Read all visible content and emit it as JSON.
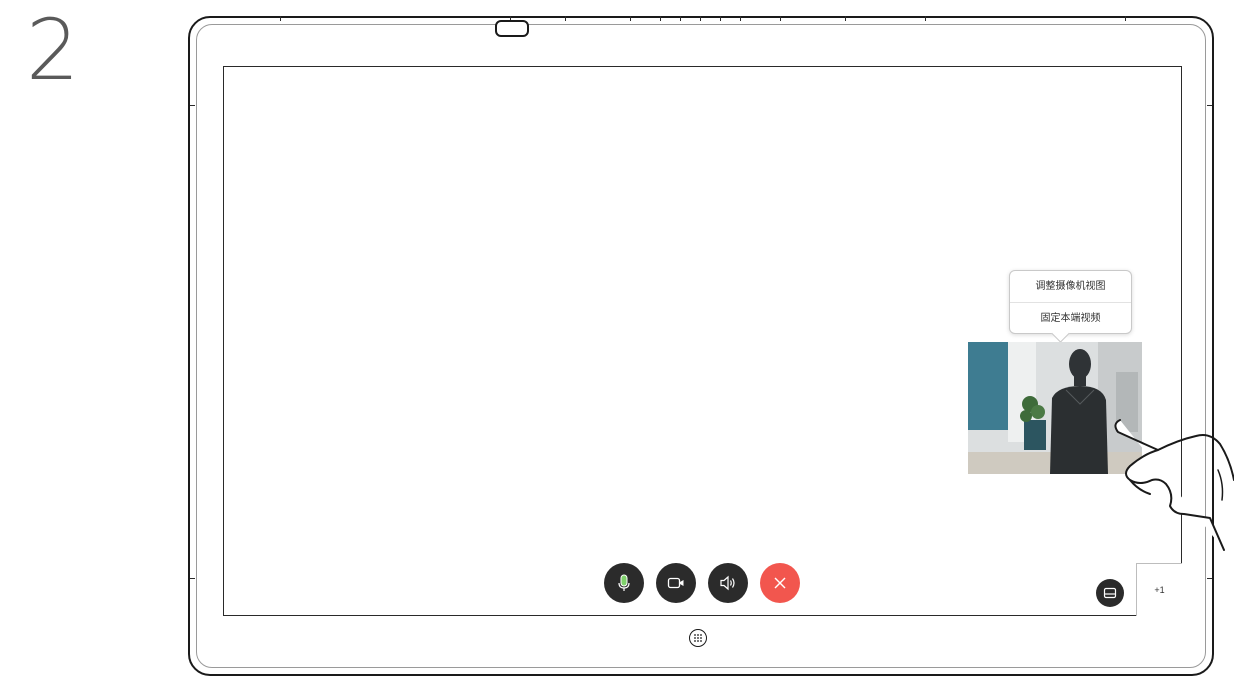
{
  "step": {
    "number": "2"
  },
  "popup_menu": {
    "items": [
      {
        "label": "调整摄像机视图"
      },
      {
        "label": "固定本端视频"
      }
    ]
  },
  "self_view": {
    "icon": "person-silhouette-icon"
  },
  "call_controls": {
    "mute_icon": "microphone-icon",
    "video_icon": "video-camera-icon",
    "volume_icon": "speaker-icon",
    "end_icon": "close-icon",
    "end_color": "#f2564e",
    "button_color": "#2b2b2b"
  },
  "layout_button": {
    "icon": "layout-icon"
  },
  "more_tab": {
    "label": "+1"
  },
  "home_button": {
    "icon": "grid-icon"
  }
}
